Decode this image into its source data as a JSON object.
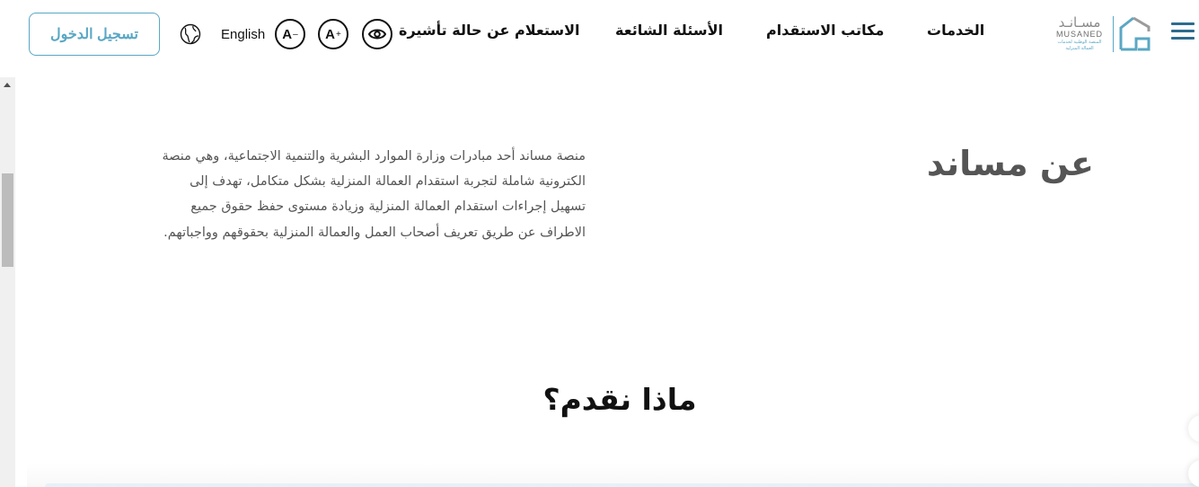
{
  "header": {
    "login_label": "تسجيل الدخول",
    "language_label": "English",
    "font_decrease_label": "A",
    "font_decrease_sign": "–",
    "font_increase_label": "A",
    "font_increase_sign": "+",
    "nav": {
      "visa_inquiry": "الاستعلام عن حالة تأشيرة",
      "faq": "الأسئلة الشائعة",
      "recruitment_offices": "مكاتب الاستقدام",
      "services": "الخدمات"
    },
    "logo": {
      "arabic": "مسـانـد",
      "english": "MUSANED",
      "sub_line1": "المنصة الوطنية لخدمات",
      "sub_line2": "العمالة المنزلية"
    }
  },
  "about": {
    "title": "عن مساند",
    "text": "منصة مساند أحد مبادرات وزارة الموارد البشرية والتنمية الاجتماعية، وهي منصة الكترونية شاملة لتجربة استقدام العمالة المنزلية بشكل متكامل، تهدف إلى تسهيل إجراءات استقدام العمالة المنزلية وزيادة مستوى حفظ حقوق جميع الاطراف عن طريق تعريف أصحاب العمل والعمالة المنزلية بحقوقهم وواجباتهم."
  },
  "offer": {
    "title": "ماذا نقدم؟"
  },
  "colors": {
    "brand_blue": "#5aa7c4",
    "brand_dark": "#2d6b8e",
    "text_gray": "#555555"
  },
  "icons": {
    "language": "globe-icon",
    "accessibility": "eye-icon",
    "menu": "hamburger-icon"
  }
}
